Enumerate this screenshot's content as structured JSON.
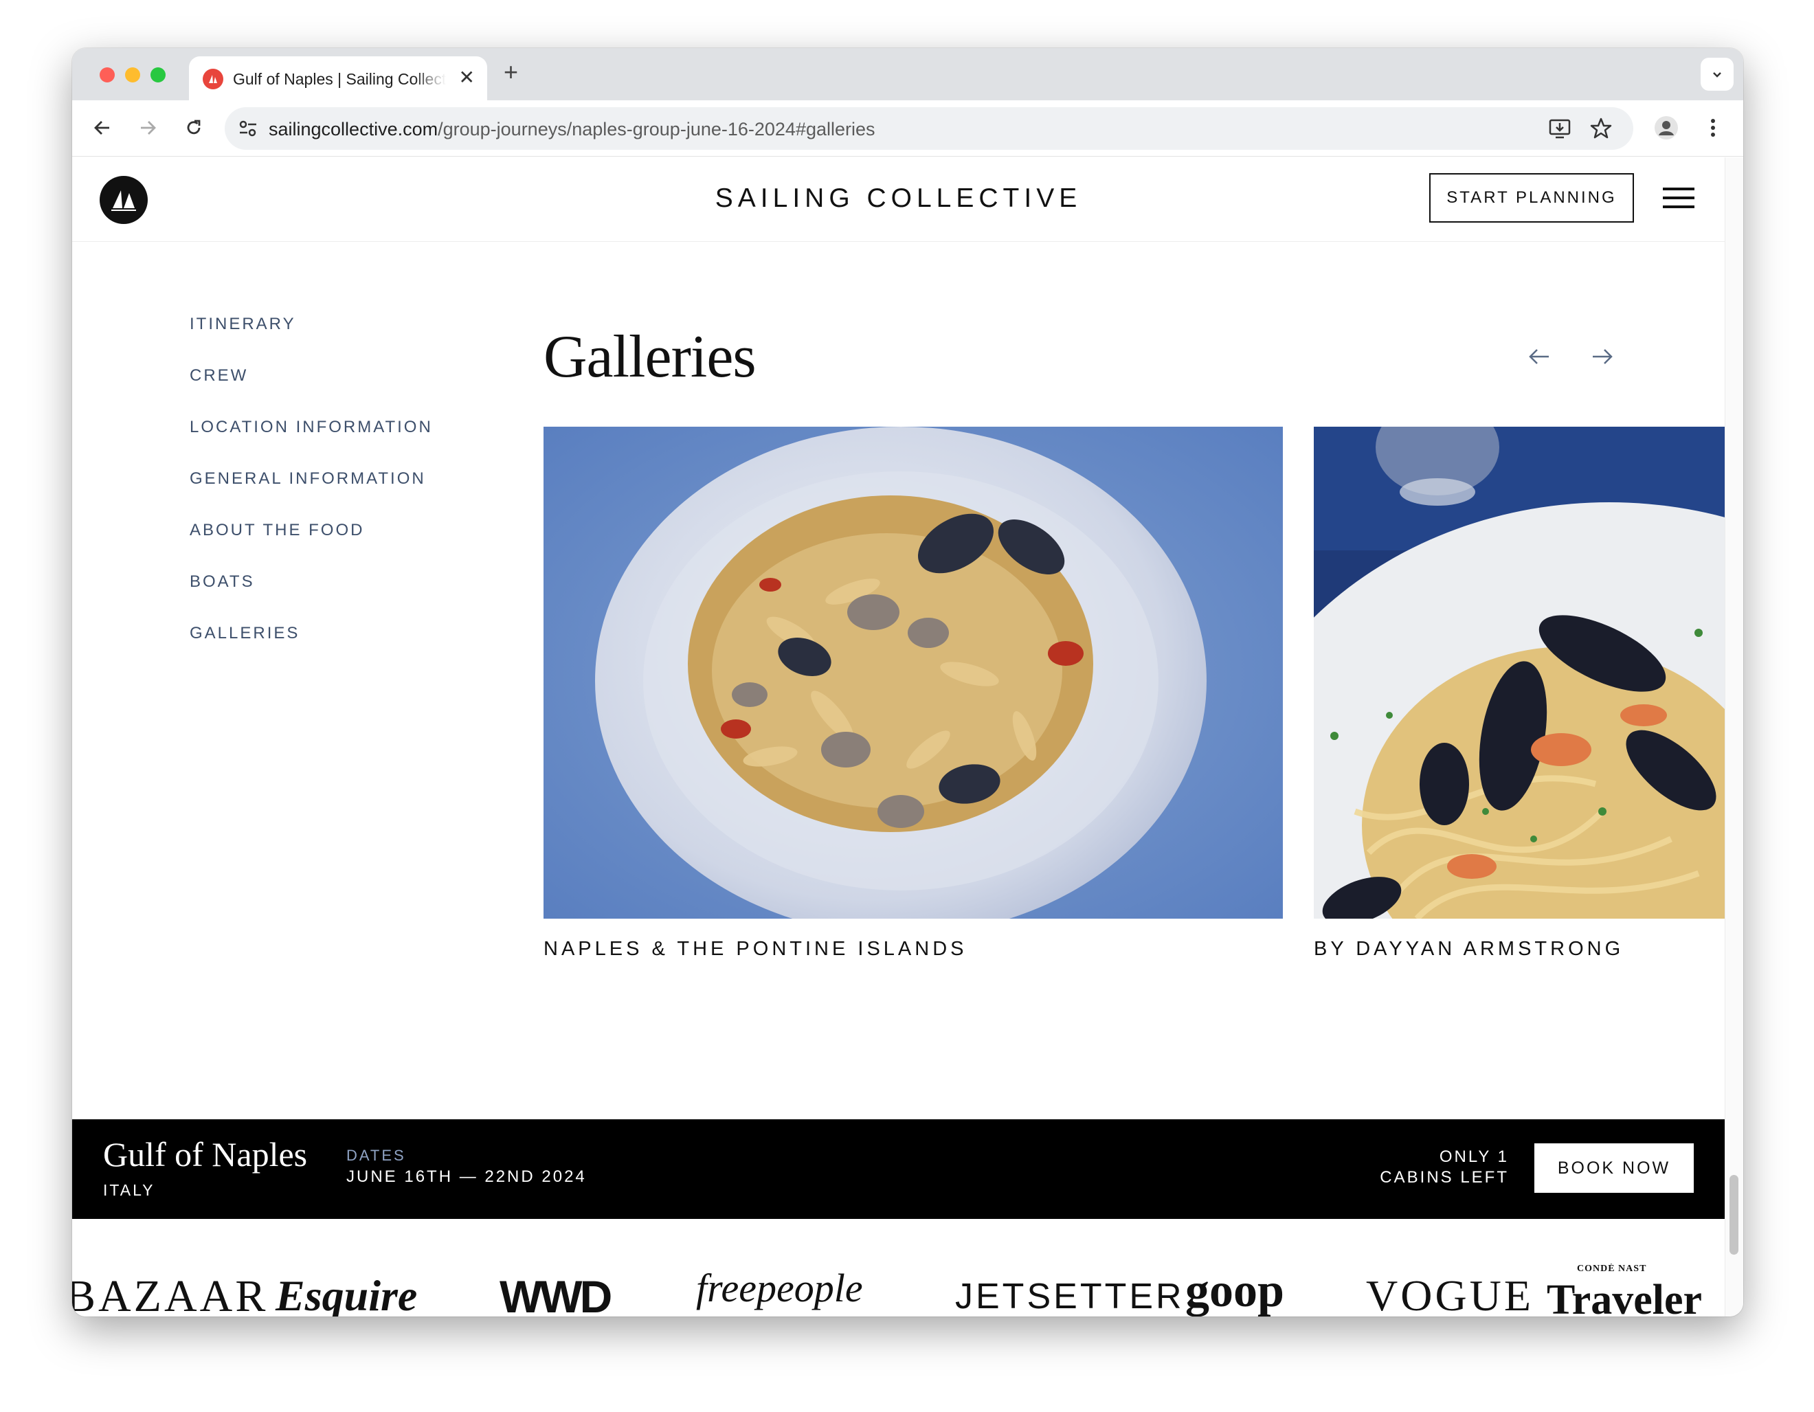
{
  "browser": {
    "tab_title": "Gulf of Naples | Sailing Collective",
    "tab_close": "✕",
    "new_tab": "+",
    "url_domain": "sailingcollective.com",
    "url_path": "/group-journeys/naples-group-june-16-2024#galleries"
  },
  "header": {
    "brand": "SAILING COLLECTIVE",
    "start_planning": "START PLANNING"
  },
  "sidenav": {
    "items": [
      {
        "label": "ITINERARY"
      },
      {
        "label": "CREW"
      },
      {
        "label": "LOCATION INFORMATION"
      },
      {
        "label": "GENERAL INFORMATION"
      },
      {
        "label": "ABOUT THE FOOD"
      },
      {
        "label": "BOATS"
      },
      {
        "label": "GALLERIES"
      }
    ]
  },
  "galleries": {
    "title": "Galleries",
    "cards": [
      {
        "caption": "NAPLES & THE PONTINE ISLANDS"
      },
      {
        "caption": "BY DAYYAN ARMSTRONG"
      }
    ]
  },
  "booking": {
    "title": "Gulf of Naples",
    "country": "ITALY",
    "dates_label": "DATES",
    "dates": "JUNE 16TH — 22ND 2024",
    "cabins_line1": "ONLY 1",
    "cabins_line2": "CABINS LEFT",
    "book_now": "BOOK NOW"
  },
  "press_logos": [
    "BAZAAR",
    "Esquire",
    "WWD",
    "freepeople",
    "JETSETTER",
    "goop",
    "VOGUE",
    "Traveler"
  ],
  "press_small": "CONDÉ NAST",
  "colors": {
    "nav_text": "#3d4f6b",
    "dates_label": "#8fa3c4",
    "booking_bar": "#000000"
  }
}
